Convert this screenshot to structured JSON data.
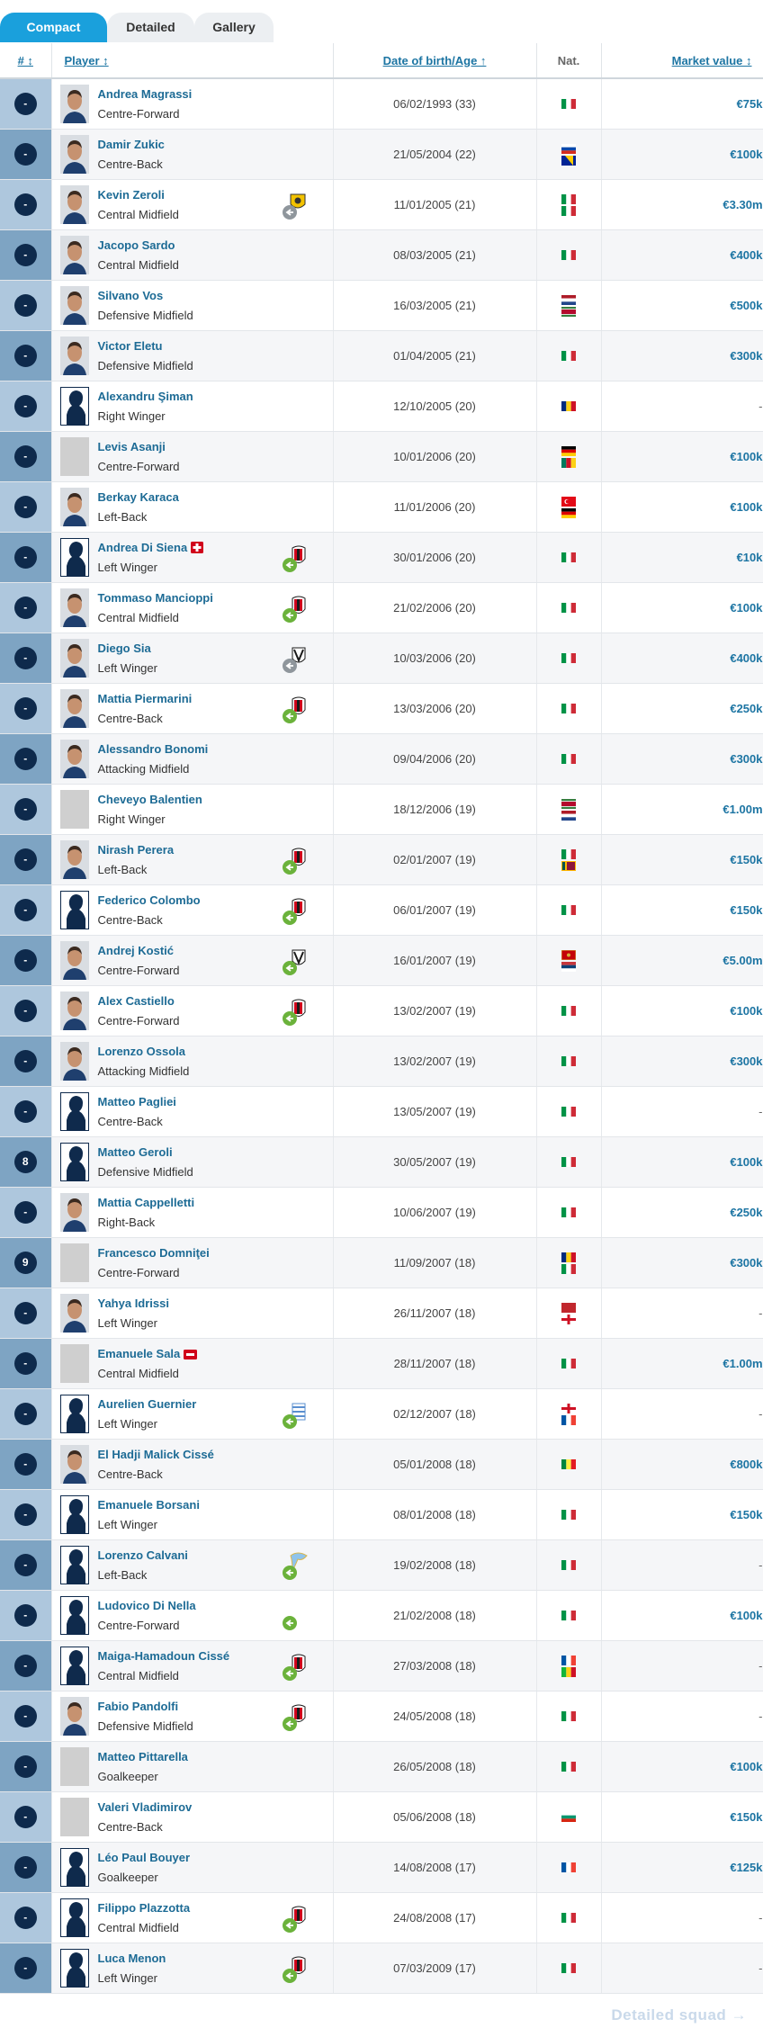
{
  "tabs": [
    "Compact",
    "Detailed",
    "Gallery"
  ],
  "active_tab": 0,
  "headers": {
    "num": "# ↕",
    "player": "Player ↕",
    "dob": "Date of birth/Age ↑",
    "nat": "Nat.",
    "value": "Market value ↕"
  },
  "footer": {
    "detailed_squad": "Detailed squad →"
  },
  "colors": {
    "accent": "#1aa0dc",
    "link": "#1d75a3",
    "num_col_light": "#aec7dd",
    "num_col_dark": "#7ea4c3",
    "badge": "#0e2a4c"
  },
  "players": [
    {
      "num": "-",
      "name": "Andrea Magrassi",
      "pos": "Centre-Forward",
      "dob": "06/02/1993 (33)",
      "nat": [
        "it"
      ],
      "value": "€75k",
      "avatar": "photo",
      "club": ""
    },
    {
      "num": "-",
      "name": "Damir Zukic",
      "pos": "Centre-Back",
      "dob": "21/05/2004 (22)",
      "nat": [
        "si",
        "ba"
      ],
      "value": "€100k",
      "avatar": "photo",
      "club": ""
    },
    {
      "num": "-",
      "name": "Kevin Zeroli",
      "pos": "Central Midfield",
      "dob": "11/01/2005 (21)",
      "nat": [
        "it",
        "it"
      ],
      "value": "€3.30m",
      "avatar": "photo",
      "club": "yellow-out"
    },
    {
      "num": "-",
      "name": "Jacopo Sardo",
      "pos": "Central Midfield",
      "dob": "08/03/2005 (21)",
      "nat": [
        "it"
      ],
      "value": "€400k",
      "avatar": "photo",
      "club": ""
    },
    {
      "num": "-",
      "name": "Silvano Vos",
      "pos": "Defensive Midfield",
      "dob": "16/03/2005 (21)",
      "nat": [
        "nl",
        "sr"
      ],
      "value": "€500k",
      "avatar": "photo",
      "club": ""
    },
    {
      "num": "-",
      "name": "Victor Eletu",
      "pos": "Defensive Midfield",
      "dob": "01/04/2005 (21)",
      "nat": [
        "it"
      ],
      "value": "€300k",
      "avatar": "photo",
      "club": ""
    },
    {
      "num": "-",
      "name": "Alexandru Şiman",
      "pos": "Right Winger",
      "dob": "12/10/2005 (20)",
      "nat": [
        "ro"
      ],
      "value": "-",
      "avatar": "sil",
      "club": ""
    },
    {
      "num": "-",
      "name": "Levis Asanji",
      "pos": "Centre-Forward",
      "dob": "10/01/2006 (20)",
      "nat": [
        "de",
        "cm"
      ],
      "value": "€100k",
      "avatar": "gray",
      "club": ""
    },
    {
      "num": "-",
      "name": "Berkay Karaca",
      "pos": "Left-Back",
      "dob": "11/01/2006 (20)",
      "nat": [
        "tr",
        "de"
      ],
      "value": "€100k",
      "avatar": "photo",
      "club": ""
    },
    {
      "num": "-",
      "name": "Andrea Di Siena",
      "pos": "Left Winger",
      "dob": "30/01/2006 (20)",
      "nat": [
        "it"
      ],
      "value": "€10k",
      "avatar": "sil",
      "club": "milan-in",
      "injury": true
    },
    {
      "num": "-",
      "name": "Tommaso Mancioppi",
      "pos": "Central Midfield",
      "dob": "21/02/2006 (20)",
      "nat": [
        "it"
      ],
      "value": "€100k",
      "avatar": "photo",
      "club": "milan-in"
    },
    {
      "num": "-",
      "name": "Diego Sia",
      "pos": "Left Winger",
      "dob": "10/03/2006 (20)",
      "nat": [
        "it"
      ],
      "value": "€400k",
      "avatar": "photo",
      "club": "bw-out"
    },
    {
      "num": "-",
      "name": "Mattia Piermarini",
      "pos": "Centre-Back",
      "dob": "13/03/2006 (20)",
      "nat": [
        "it"
      ],
      "value": "€250k",
      "avatar": "photo",
      "club": "milan-in"
    },
    {
      "num": "-",
      "name": "Alessandro Bonomi",
      "pos": "Attacking Midfield",
      "dob": "09/04/2006 (20)",
      "nat": [
        "it"
      ],
      "value": "€300k",
      "avatar": "photo",
      "club": ""
    },
    {
      "num": "-",
      "name": "Cheveyo Balentien",
      "pos": "Right Winger",
      "dob": "18/12/2006 (19)",
      "nat": [
        "sr",
        "nl"
      ],
      "value": "€1.00m",
      "avatar": "gray",
      "club": ""
    },
    {
      "num": "-",
      "name": "Nirash Perera",
      "pos": "Left-Back",
      "dob": "02/01/2007 (19)",
      "nat": [
        "it",
        "lk"
      ],
      "value": "€150k",
      "avatar": "photo",
      "club": "milan-in"
    },
    {
      "num": "-",
      "name": "Federico Colombo",
      "pos": "Centre-Back",
      "dob": "06/01/2007 (19)",
      "nat": [
        "it"
      ],
      "value": "€150k",
      "avatar": "sil",
      "club": "milan-in"
    },
    {
      "num": "-",
      "name": "Andrej Kostić",
      "pos": "Centre-Forward",
      "dob": "16/01/2007 (19)",
      "nat": [
        "me",
        "rs"
      ],
      "value": "€5.00m",
      "avatar": "photo",
      "club": "bw-in"
    },
    {
      "num": "-",
      "name": "Alex Castiello",
      "pos": "Centre-Forward",
      "dob": "13/02/2007 (19)",
      "nat": [
        "it"
      ],
      "value": "€100k",
      "avatar": "photo",
      "club": "milan-in"
    },
    {
      "num": "-",
      "name": "Lorenzo Ossola",
      "pos": "Attacking Midfield",
      "dob": "13/02/2007 (19)",
      "nat": [
        "it"
      ],
      "value": "€300k",
      "avatar": "photo",
      "club": ""
    },
    {
      "num": "-",
      "name": "Matteo Pagliei",
      "pos": "Centre-Back",
      "dob": "13/05/2007 (19)",
      "nat": [
        "it"
      ],
      "value": "-",
      "avatar": "sil",
      "club": ""
    },
    {
      "num": "8",
      "name": "Matteo Geroli",
      "pos": "Defensive Midfield",
      "dob": "30/05/2007 (19)",
      "nat": [
        "it"
      ],
      "value": "€100k",
      "avatar": "sil",
      "club": ""
    },
    {
      "num": "-",
      "name": "Mattia Cappelletti",
      "pos": "Right-Back",
      "dob": "10/06/2007 (19)",
      "nat": [
        "it"
      ],
      "value": "€250k",
      "avatar": "photo",
      "club": ""
    },
    {
      "num": "9",
      "name": "Francesco Domniţei",
      "pos": "Centre-Forward",
      "dob": "11/09/2007 (18)",
      "nat": [
        "ro",
        "it"
      ],
      "value": "€300k",
      "avatar": "gray",
      "club": ""
    },
    {
      "num": "-",
      "name": "Yahya Idrissi",
      "pos": "Left Winger",
      "dob": "26/11/2007 (18)",
      "nat": [
        "ma",
        "en"
      ],
      "value": "-",
      "avatar": "photo",
      "club": ""
    },
    {
      "num": "-",
      "name": "Emanuele Sala",
      "pos": "Central Midfield",
      "dob": "28/11/2007 (18)",
      "nat": [
        "it"
      ],
      "value": "€1.00m",
      "avatar": "gray",
      "club": "",
      "badge": "sick"
    },
    {
      "num": "-",
      "name": "Aurelien Guernier",
      "pos": "Left Winger",
      "dob": "02/12/2007 (18)",
      "nat": [
        "en",
        "fr"
      ],
      "value": "-",
      "avatar": "sil",
      "club": "stripe-in"
    },
    {
      "num": "-",
      "name": "El Hadji Malick Cissé",
      "pos": "Centre-Back",
      "dob": "05/01/2008 (18)",
      "nat": [
        "sn"
      ],
      "value": "€800k",
      "avatar": "photo",
      "club": ""
    },
    {
      "num": "-",
      "name": "Emanuele Borsani",
      "pos": "Left Winger",
      "dob": "08/01/2008 (18)",
      "nat": [
        "it"
      ],
      "value": "€150k",
      "avatar": "sil",
      "club": ""
    },
    {
      "num": "-",
      "name": "Lorenzo Calvani",
      "pos": "Left-Back",
      "dob": "19/02/2008 (18)",
      "nat": [
        "it"
      ],
      "value": "-",
      "avatar": "sil",
      "club": "lazio-in"
    },
    {
      "num": "-",
      "name": "Ludovico Di Nella",
      "pos": "Centre-Forward",
      "dob": "21/02/2008 (18)",
      "nat": [
        "it"
      ],
      "value": "€100k",
      "avatar": "sil",
      "club": "plain-in"
    },
    {
      "num": "-",
      "name": "Maiga-Hamadoun Cissé",
      "pos": "Central Midfield",
      "dob": "27/03/2008 (18)",
      "nat": [
        "fr",
        "ml"
      ],
      "value": "-",
      "avatar": "sil",
      "club": "milan-in"
    },
    {
      "num": "-",
      "name": "Fabio Pandolfi",
      "pos": "Defensive Midfield",
      "dob": "24/05/2008 (18)",
      "nat": [
        "it"
      ],
      "value": "-",
      "avatar": "photo",
      "club": "milan-in"
    },
    {
      "num": "-",
      "name": "Matteo Pittarella",
      "pos": "Goalkeeper",
      "dob": "26/05/2008 (18)",
      "nat": [
        "it"
      ],
      "value": "€100k",
      "avatar": "gray",
      "club": ""
    },
    {
      "num": "-",
      "name": "Valeri Vladimirov",
      "pos": "Centre-Back",
      "dob": "05/06/2008 (18)",
      "nat": [
        "bg"
      ],
      "value": "€150k",
      "avatar": "gray",
      "club": ""
    },
    {
      "num": "-",
      "name": "Léo Paul Bouyer",
      "pos": "Goalkeeper",
      "dob": "14/08/2008 (17)",
      "nat": [
        "fr"
      ],
      "value": "€125k",
      "avatar": "sil",
      "club": ""
    },
    {
      "num": "-",
      "name": "Filippo Plazzotta",
      "pos": "Central Midfield",
      "dob": "24/08/2008 (17)",
      "nat": [
        "it"
      ],
      "value": "-",
      "avatar": "sil",
      "club": "milan-in"
    },
    {
      "num": "-",
      "name": "Luca Menon",
      "pos": "Left Winger",
      "dob": "07/03/2009 (17)",
      "nat": [
        "it"
      ],
      "value": "-",
      "avatar": "sil",
      "club": "milan-in"
    }
  ]
}
